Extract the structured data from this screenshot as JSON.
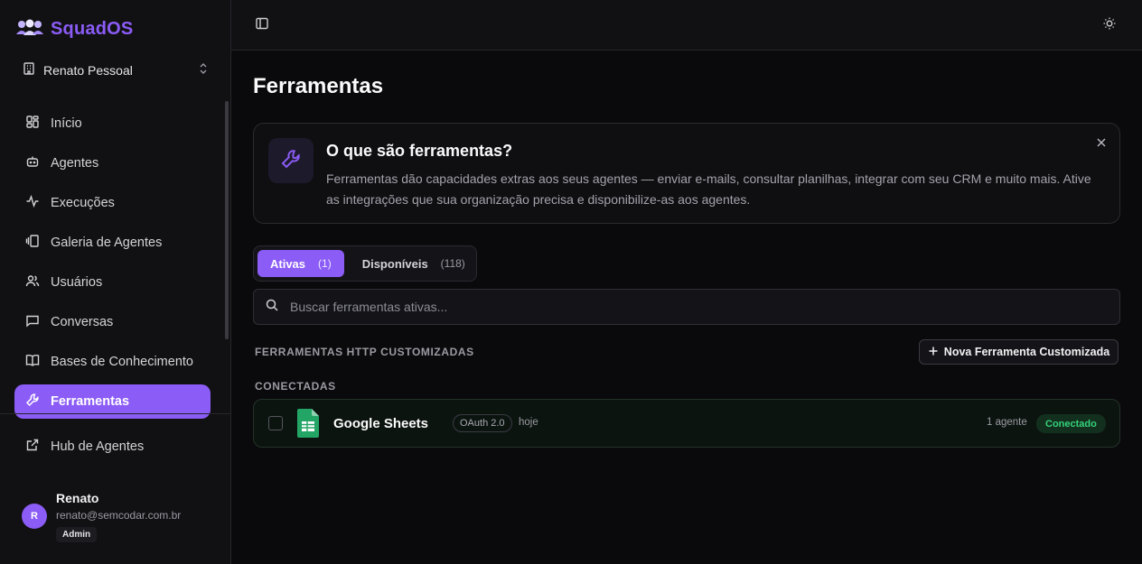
{
  "brand": {
    "name": "SquadOS",
    "accent": "#8b5cf6"
  },
  "org": {
    "name": "Renato Pessoal"
  },
  "sidebar": {
    "items": [
      {
        "label": "Início",
        "icon": "layout-grid-icon"
      },
      {
        "label": "Agentes",
        "icon": "bot-icon"
      },
      {
        "label": "Execuções",
        "icon": "activity-icon"
      },
      {
        "label": "Galeria de Agentes",
        "icon": "gallery-icon"
      },
      {
        "label": "Usuários",
        "icon": "users-icon"
      },
      {
        "label": "Conversas",
        "icon": "message-square-icon"
      },
      {
        "label": "Bases de Conhecimento",
        "icon": "book-open-icon"
      },
      {
        "label": "Ferramentas",
        "icon": "wrench-icon",
        "active": true
      }
    ],
    "hub": {
      "label": "Hub de Agentes",
      "icon": "external-link-icon"
    }
  },
  "user": {
    "initial": "R",
    "name": "Renato",
    "email": "renato@semcodar.com.br",
    "role": "Admin"
  },
  "page": {
    "title": "Ferramentas"
  },
  "info": {
    "title": "O que são ferramentas?",
    "text": "Ferramentas dão capacidades extras aos seus agentes — enviar e-mails, consultar planilhas, integrar com seu CRM e muito mais. Ative as integrações que sua organização precisa e disponibilize-as aos agentes."
  },
  "tabs": [
    {
      "label": "Ativas",
      "count": "(1)",
      "active": true
    },
    {
      "label": "Disponíveis",
      "count": "(118)"
    }
  ],
  "search": {
    "placeholder": "Buscar ferramentas ativas..."
  },
  "custom": {
    "label": "FERRAMENTAS HTTP CUSTOMIZADAS",
    "button": "Nova Ferramenta Customizada"
  },
  "connected": {
    "label": "CONECTADAS",
    "tools": [
      {
        "name": "Google Sheets",
        "auth": "OAuth 2.0",
        "date": "hoje",
        "agents": "1 agente",
        "status": "Conectado",
        "status_color": "#34d27a"
      }
    ]
  }
}
